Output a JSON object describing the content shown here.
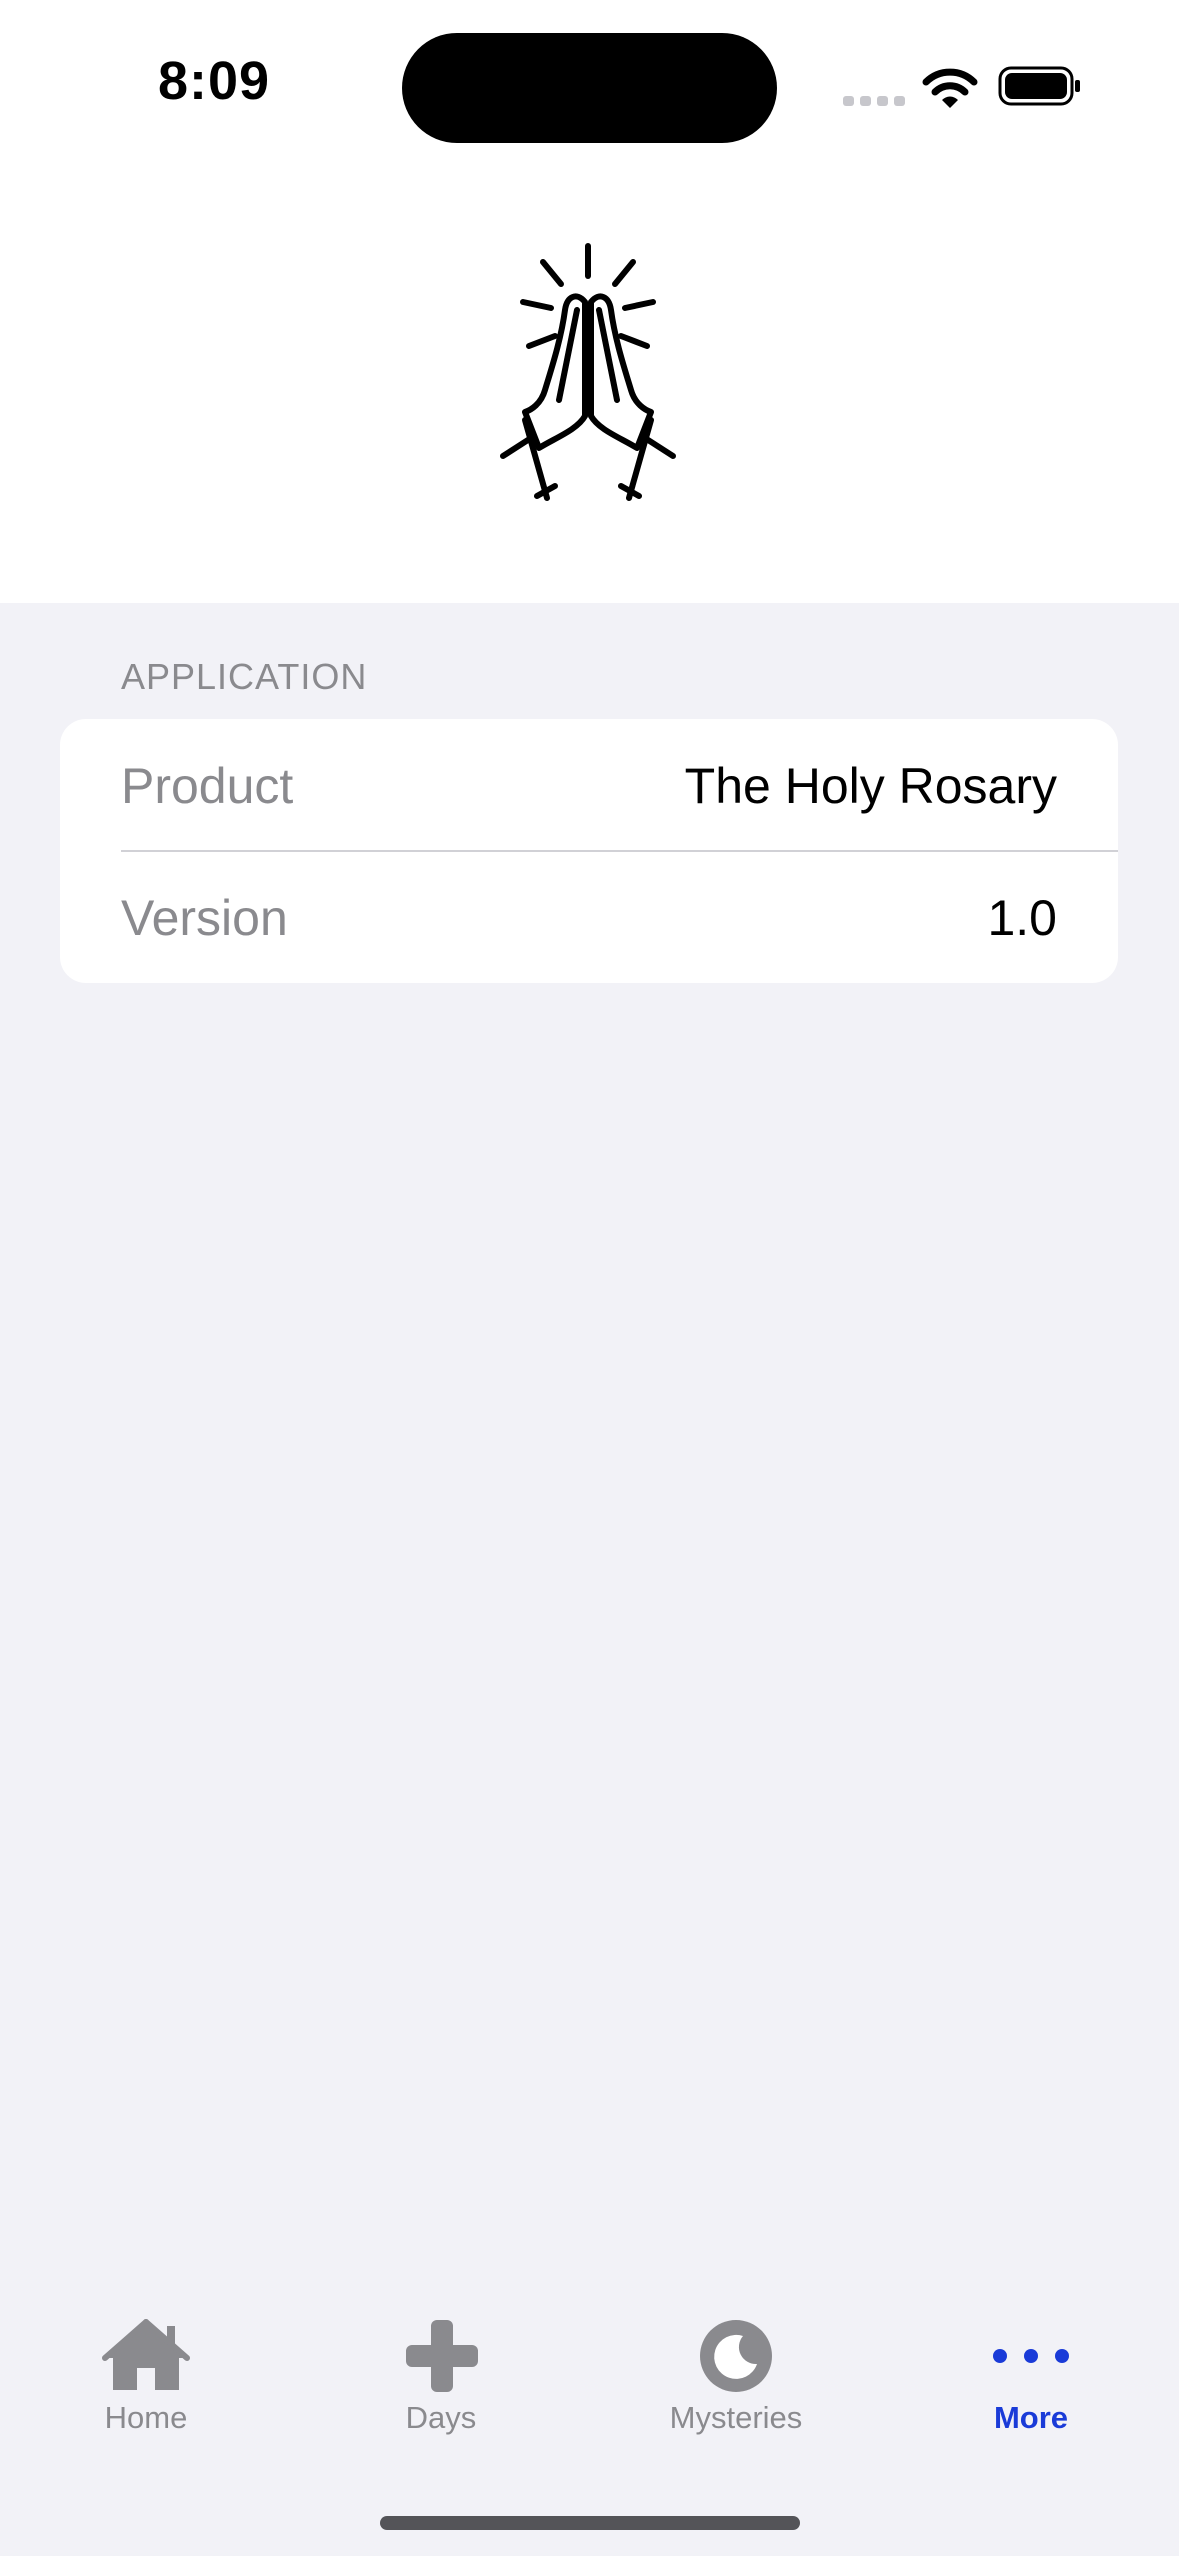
{
  "status_bar": {
    "time": "8:09"
  },
  "header": {
    "icon": "praying-hands-icon"
  },
  "section": {
    "title": "APPLICATION",
    "rows": [
      {
        "label": "Product",
        "value": "The Holy Rosary"
      },
      {
        "label": "Version",
        "value": "1.0"
      }
    ]
  },
  "tabbar": {
    "items": [
      {
        "label": "Home",
        "icon": "house-icon",
        "active": false
      },
      {
        "label": "Days",
        "icon": "cross-icon",
        "active": false
      },
      {
        "label": "Mysteries",
        "icon": "moon-icon",
        "active": false
      },
      {
        "label": "More",
        "icon": "ellipsis-icon",
        "active": true
      }
    ]
  },
  "colors": {
    "background": "#f2f2f7",
    "card": "#ffffff",
    "secondary_text": "#8a8a8e",
    "accent": "#1a3bd8"
  }
}
